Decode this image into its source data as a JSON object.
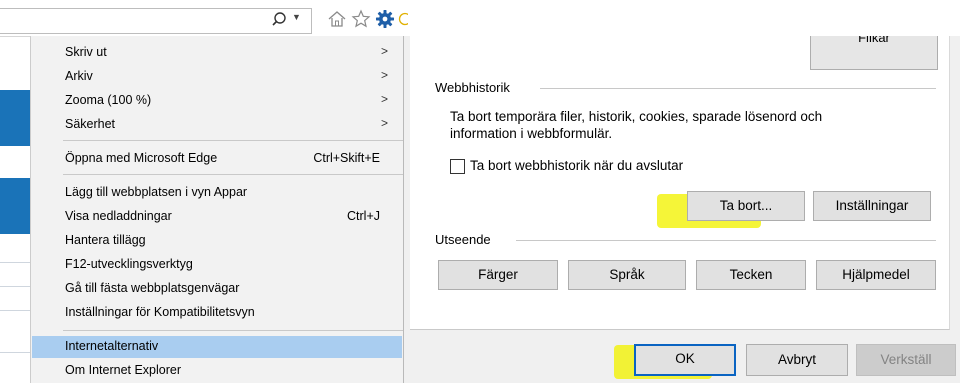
{
  "browser": {
    "address_value": "",
    "icons": [
      "search-icon",
      "home-icon",
      "star-icon",
      "gear-icon"
    ]
  },
  "context_menu": {
    "items": [
      {
        "label": "Skriv ut",
        "shortcut": "",
        "submenu": true
      },
      {
        "label": "Arkiv",
        "shortcut": "",
        "submenu": true
      },
      {
        "label": "Zooma (100 %)",
        "shortcut": "",
        "submenu": true
      },
      {
        "label": "Säkerhet",
        "shortcut": "",
        "submenu": true
      },
      {
        "label": "Öppna med Microsoft Edge",
        "shortcut": "Ctrl+Skift+E",
        "submenu": false
      },
      {
        "label": "Lägg till webbplatsen i vyn Appar",
        "shortcut": "",
        "submenu": false
      },
      {
        "label": "Visa nedladdningar",
        "shortcut": "Ctrl+J",
        "submenu": false
      },
      {
        "label": "Hantera tillägg",
        "shortcut": "",
        "submenu": false
      },
      {
        "label": "F12-utvecklingsverktyg",
        "shortcut": "",
        "submenu": false
      },
      {
        "label": "Gå till fästa webbplatsgenvägar",
        "shortcut": "",
        "submenu": false
      },
      {
        "label": "Inställningar för Kompatibilitetsvyn",
        "shortcut": "",
        "submenu": false
      },
      {
        "label": "Internetalternativ",
        "shortcut": "",
        "submenu": false,
        "highlighted": true
      },
      {
        "label": "Om Internet Explorer",
        "shortcut": "",
        "submenu": false
      }
    ]
  },
  "dialog": {
    "top_button_label": "Flikar",
    "webbhistorik": {
      "title": "Webbhistorik",
      "description_line1": "Ta bort temporära filer, historik, cookies, sparade lösenord och",
      "description_line2": "information i webbformulär.",
      "checkbox_label": "Ta bort webbhistorik när du avslutar",
      "checkbox_checked": false,
      "delete_button": "Ta bort...",
      "settings_button": "Inställningar"
    },
    "utseende": {
      "title": "Utseende",
      "buttons": [
        "Färger",
        "Språk",
        "Tecken",
        "Hjälpmedel"
      ]
    },
    "footer": {
      "ok": "OK",
      "cancel": "Avbryt",
      "apply": "Verkställ"
    }
  },
  "colors": {
    "menu_highlight": "#a9cdf0",
    "annotation_highlight": "#f2f200",
    "default_button_border": "#0a64c2",
    "gear_blue": "#1f5fa8"
  }
}
